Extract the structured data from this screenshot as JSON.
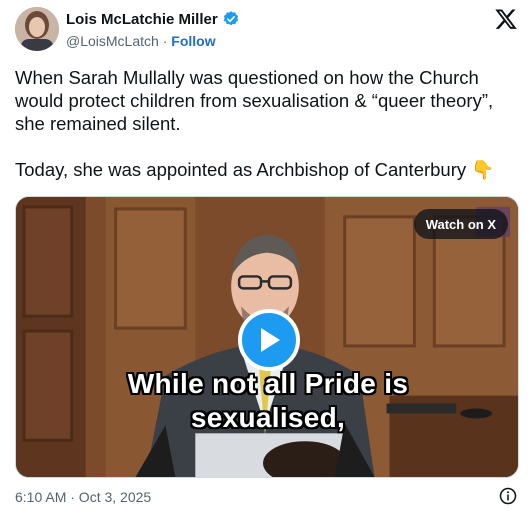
{
  "author": {
    "name": "Lois McLatchie Miller",
    "handle": "@LoisMcLatch",
    "separator": "·",
    "follow_label": "Follow",
    "verified": true
  },
  "icons": {
    "avatar": "avatar",
    "verified": "verified-badge-icon",
    "platform": "x-logo-icon",
    "play": "play-icon",
    "info": "info-icon"
  },
  "tweet": {
    "line1": "When Sarah Mullally was questioned on how the Church would protect children from sexualisation & “queer theory”, she remained silent.",
    "line2": "Today, she was appointed as Archbishop of Canterbury 👇"
  },
  "media": {
    "watch_label": "Watch on X",
    "caption_line1": "While not all Pride is",
    "caption_line2": "sexualised,"
  },
  "footer": {
    "timestamp": "6:10 AM · Oct 3, 2025"
  },
  "colors": {
    "accent": "#1d9bf0",
    "follow": "#1d6fc9",
    "muted": "#536471"
  }
}
